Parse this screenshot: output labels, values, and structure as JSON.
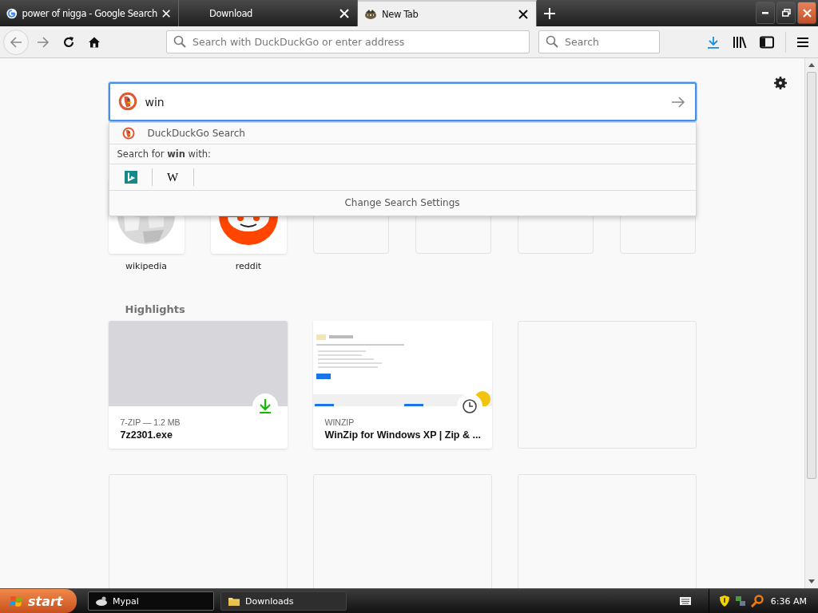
{
  "tabs": [
    {
      "title": "power of nigga - Google Search",
      "selected": false
    },
    {
      "title": "Download",
      "selected": false
    },
    {
      "title": "New Tab",
      "selected": true
    }
  ],
  "address_bar": {
    "placeholder": "Search with DuckDuckGo or enter address"
  },
  "search_bar": {
    "placeholder": "Search"
  },
  "page_search": {
    "value": "win",
    "suggestion": "DuckDuckGo Search",
    "search_with": "Search for **win** with:",
    "engines": [
      {
        "kind": "bing"
      },
      {
        "kind": "wikipedia",
        "glyph": "W"
      }
    ],
    "settings_link": "Change Search Settings"
  },
  "top_sites": [
    {
      "kind": "wikipedia",
      "label": "wikipedia"
    },
    {
      "kind": "reddit",
      "label": "reddit"
    },
    {
      "kind": "empty"
    },
    {
      "kind": "empty"
    },
    {
      "kind": "empty"
    },
    {
      "kind": "empty"
    }
  ],
  "highlights": {
    "title": "Highlights",
    "cards": [
      {
        "kind": "download",
        "source": "7-ZIP — 1.2 MB",
        "title": "7z2301.exe"
      },
      {
        "kind": "visited",
        "source": "WINZIP",
        "title": "WinZip for Windows XP | Zip & ..."
      },
      {
        "kind": "empty"
      },
      {
        "kind": "empty"
      },
      {
        "kind": "empty"
      },
      {
        "kind": "empty"
      }
    ]
  },
  "taskbar": {
    "start": "start",
    "tasks": [
      {
        "label": "Mypal",
        "selected": true
      },
      {
        "label": "Downloads",
        "selected": false
      }
    ],
    "clock": "6:36 AM"
  }
}
